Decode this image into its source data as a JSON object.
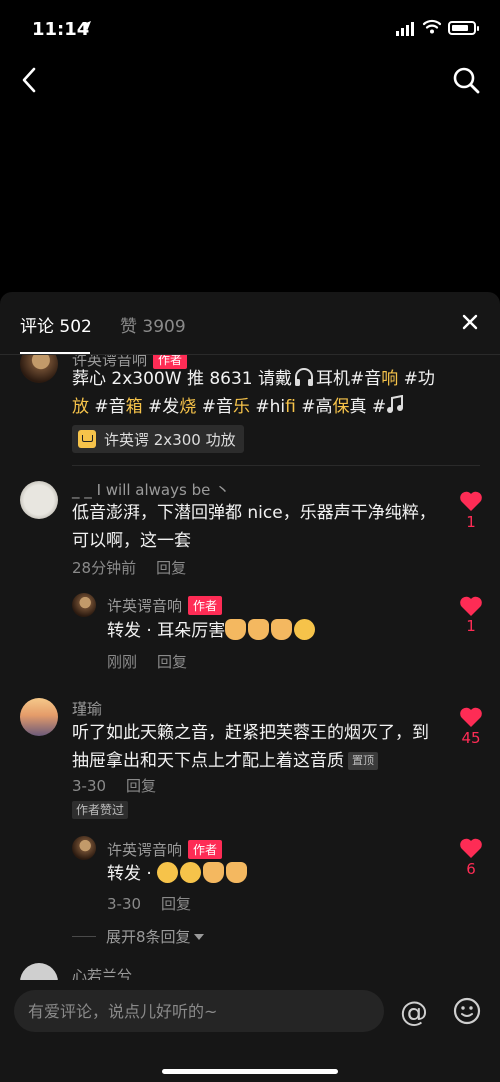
{
  "status": {
    "time": "11:14"
  },
  "tabs": {
    "comments": "评论 502",
    "likes": "赞 3909"
  },
  "pinned_post": {
    "username": "许英谔音响",
    "badge": "作者",
    "text_plain_1": "葬心 2x300W 推 8631 请戴",
    "text_plain_2": "耳机#音",
    "hl_1": "响",
    "text_plain_3": " #功",
    "hl_2": "放",
    "text_plain_4": " #音",
    "hl_3": "箱",
    "text_plain_5": " #发",
    "hl_4": "烧",
    "text_plain_6": " #音",
    "hl_5": "乐",
    "text_plain_7": " #hi",
    "hl_6": "fi",
    "text_plain_8": " #高",
    "hl_7": "保",
    "hl_8": "真",
    "text_plain_9": " #",
    "product_link": "许英谔 2x300 功放"
  },
  "comments": [
    {
      "username": "I will always be",
      "username_prefix": "_ _",
      "username_suffix": "丶",
      "text": "低音澎湃，下潜回弹都 nice，乐器声干净纯粹，可以啊，这一套",
      "time": "28分钟前",
      "reply": "回复",
      "likes": "1",
      "reply_item": {
        "username": "许英谔音响",
        "badge": "作者",
        "text": "转发 · 耳朵厉害",
        "time": "刚刚",
        "reply": "回复",
        "likes": "1"
      }
    },
    {
      "username": "瑾瑜",
      "text": "听了如此天籁之音，赶紧把芙蓉王的烟灭了，到抽屉拿出和天下点上才配上着这音质",
      "pinned_label": "置顶",
      "time": "3-30",
      "reply": "回复",
      "author_liked": "作者赞过",
      "likes": "45",
      "reply_item": {
        "username": "许英谔音响",
        "badge": "作者",
        "text": "转发 · ",
        "time": "3-30",
        "reply": "回复",
        "likes": "6"
      }
    }
  ],
  "expand_replies": "展开8条回复",
  "partial_next_user": "心若兰兮",
  "input": {
    "placeholder": "有爱评论，说点儿好听的~"
  },
  "colors": {
    "accent": "#fe2c55",
    "hashtag": "#f6c34a",
    "sheet": "#161616"
  },
  "icons": [
    "back-icon",
    "search-icon",
    "close-icon",
    "heart-icon",
    "at-icon",
    "emoji-icon",
    "cart-icon"
  ]
}
